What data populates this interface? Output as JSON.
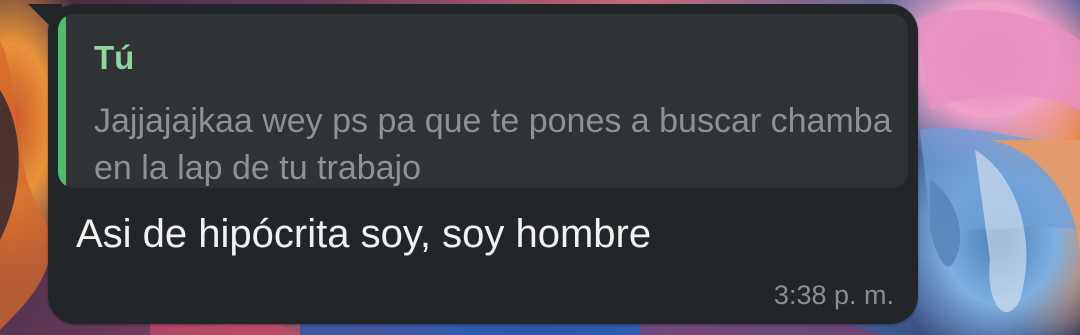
{
  "message": {
    "quoted": {
      "author": "Tú",
      "text": "Jajjajajkaa wey ps pa que te pones a buscar chamba en la lap de tu trabajo"
    },
    "text": "Asi de hipócrita soy, soy hombre",
    "time": "3:38 p. m."
  },
  "colors": {
    "bubble": "#232628",
    "quote_background": "#2f3336",
    "quote_bar": "#4fbc6a",
    "quote_author": "#8fd3a0",
    "message_text": "#f1f1f2",
    "muted_text": "#8d9194"
  }
}
